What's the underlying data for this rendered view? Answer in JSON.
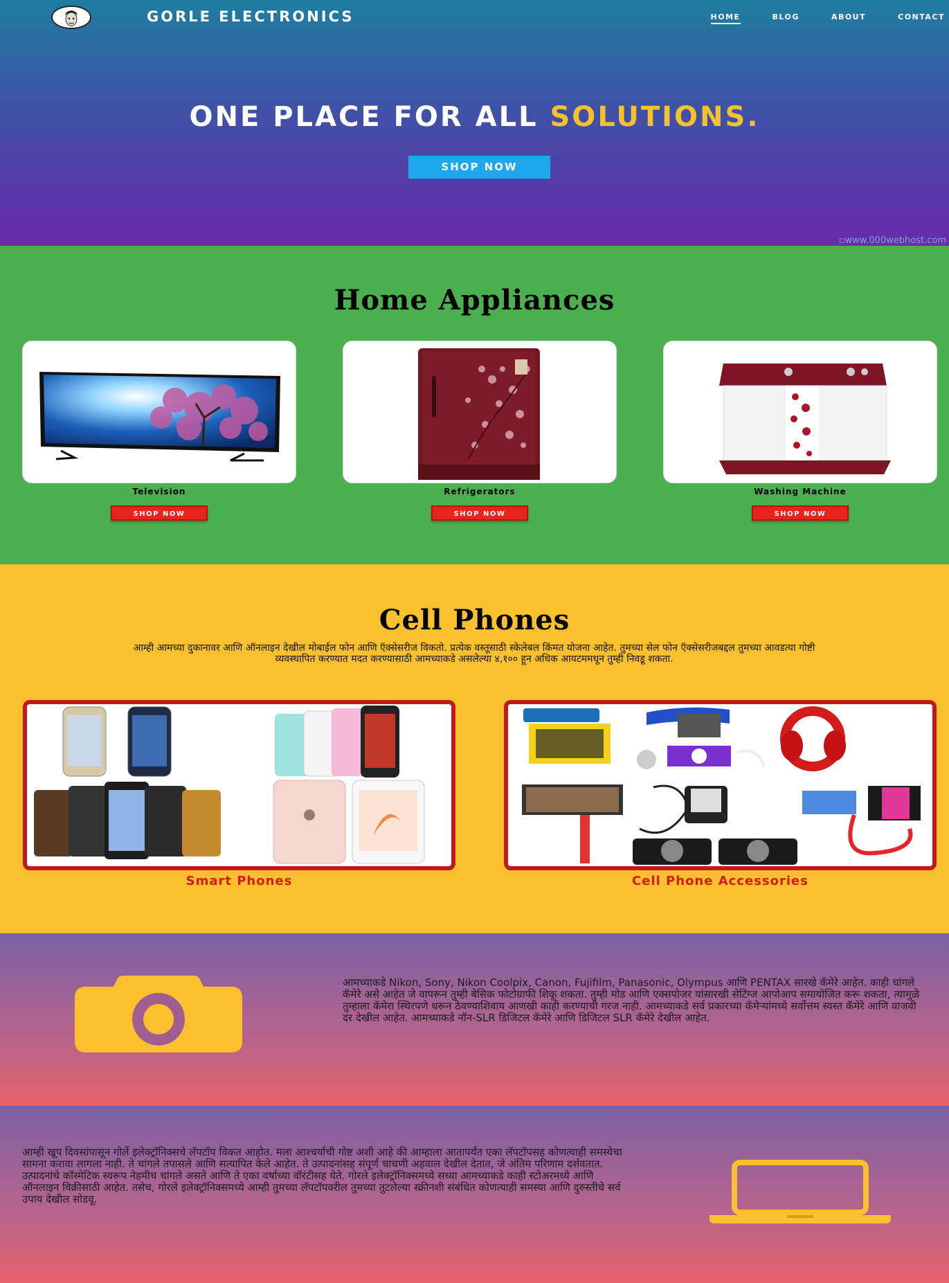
{
  "header": {
    "brand": "GORLE ELECTRONICS",
    "nav": [
      "HOME",
      "BLOG",
      "ABOUT",
      "CONTACT"
    ],
    "active_nav": "HOME"
  },
  "hero": {
    "headline_main": "ONE PLACE FOR ALL ",
    "headline_accent": "SOLUTIONS.",
    "button": "SHOP NOW",
    "host_link": "www.000webhost.com",
    "accent_color": "#f5c12e",
    "button_color": "#1da8ee"
  },
  "appliances": {
    "title": "Home Appliances",
    "items": [
      {
        "label": "Television",
        "button": "SHOP NOW"
      },
      {
        "label": "Refrigerators",
        "button": "SHOP NOW"
      },
      {
        "label": "Washing Machine",
        "button": "SHOP NOW"
      }
    ],
    "bg_color": "#4caf50",
    "button_color": "#e8251d"
  },
  "phones": {
    "title": "Cell Phones",
    "description": "आम्ही आमच्या दुकानावर आणि ऑनलाइन देखील मोबाईल फोन आणि ऍक्सेसरीज विकतो. प्रत्येक वस्तूसाठी स्केलेबल किंमत योजना आहेत. तुमच्या सेल फोन ऍक्सेसरीजबद्दल तुमच्या आवडत्या गोष्टी व्यवस्थापित करण्यात मदत करण्यासाठी आमच्याकडे असलेल्या ४,१०० हून अधिक आयटममधून तुम्ही निवडू शकता.",
    "cards": [
      {
        "label": "Smart Phones"
      },
      {
        "label": "Cell Phone Accessories"
      }
    ],
    "bg_color": "#fbc02d",
    "label_color": "#d41c1c"
  },
  "camera": {
    "icon": "camera-icon",
    "text": "आमच्याकडे Nikon, Sony, Nikon Coolpix, Canon, Fujifilm, Panasonic, Olympus आणि PENTAX सारखे कॅमेरे आहेत. काही चांगले कॅमेरे असे आहेत जे वापरून तुम्ही बेसिक फोटोग्राफी शिकू शकता. तुम्ही मोड आणि एक्सपोजर यांसारखी सेटिंग्ज आपोआप समायोजित करू शकता, त्यामुळे तुम्हाला कॅमेरा स्थिरपणे धरून ठेवण्याशिवाय आणखी काही करण्याची गरज नाही. आमच्याकडे सर्व प्रकारच्या कॅमेऱ्यांमध्ये सर्वोत्तम स्वस्त कॅमेरे आणि वाजवी दर देखील आहेत. आमच्याकडे नॉन-SLR डिजिटल कॅमेरे आणि डिजिटल SLR कॅमेरे देखील आहेत."
  },
  "laptop": {
    "icon": "laptop-icon",
    "text": "आम्ही खूप दिवसांपासून गोर्ले इलेक्ट्रॉनिक्सचे लॅपटॉप विकत आहोत. मला आश्चर्याची गोष्ट अशी आहे की आम्हाला आतापर्यंत एका लॅपटॉपसह कोणत्याही समस्येचा सामना करावा लागला नाही. ते चांगले तपासले आणि सत्यापित केले आहेत. ते उत्पादनांसह संपूर्ण चाचणी अहवाल देखील देतात, जे अंतिम परिणाम दर्शवतात. उत्पादनांचे कॉस्मेटिक स्वरूप नेहमीच चांगले असते आणि ते एका वर्षाच्या वॉरंटीसह येते. गोरले इलेक्ट्रॉनिक्समध्ये सध्या आमच्याकडे काही स्टोअरमध्ये आणि ऑनलाइन विक्रीसाठी आहेत. तसेच, गोरले इलेक्ट्रॉनिक्समध्ये आम्ही तुमच्या लॅपटॉपवरील तुमच्या तुटलेल्या स्क्रीनशी संबंधित कोणत्याही समस्या आणि दुरुस्तीचे सर्व उपाय देखील सोडवू."
  }
}
